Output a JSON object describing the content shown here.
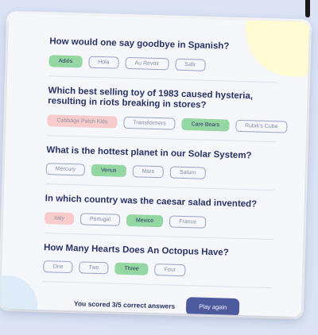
{
  "questions": [
    {
      "title": "How would one say goodbye in Spanish?",
      "answers": [
        "Adiós",
        "Hola",
        "Au Revoir",
        "Salir"
      ]
    },
    {
      "title": "Which best selling toy of 1983 caused hysteria, resulting in riots breaking in stores?",
      "answers": [
        "Cabbage Patch Kids",
        "Transformers",
        "Care Bears",
        "Rubik's Cube"
      ]
    },
    {
      "title": "What is the hottest planet in our Solar System?",
      "answers": [
        "Mercury",
        "Venus",
        "Mars",
        "Saturn"
      ]
    },
    {
      "title": "In which country was the caesar salad invented?",
      "answers": [
        "Italy",
        "Portugal",
        "Mexico",
        "France"
      ]
    },
    {
      "title": "How Many Hearts Does An Octopus Have?",
      "answers": [
        "One",
        "Two",
        "Three",
        "Four"
      ]
    }
  ],
  "footer": {
    "score_text": "You scored 3/5 correct answers",
    "play_again_label": "Play again"
  },
  "colors": {
    "correct": "#94d7a2",
    "wrong": "#f8bcbc",
    "primary": "#4d5b9e",
    "text": "#293264"
  }
}
